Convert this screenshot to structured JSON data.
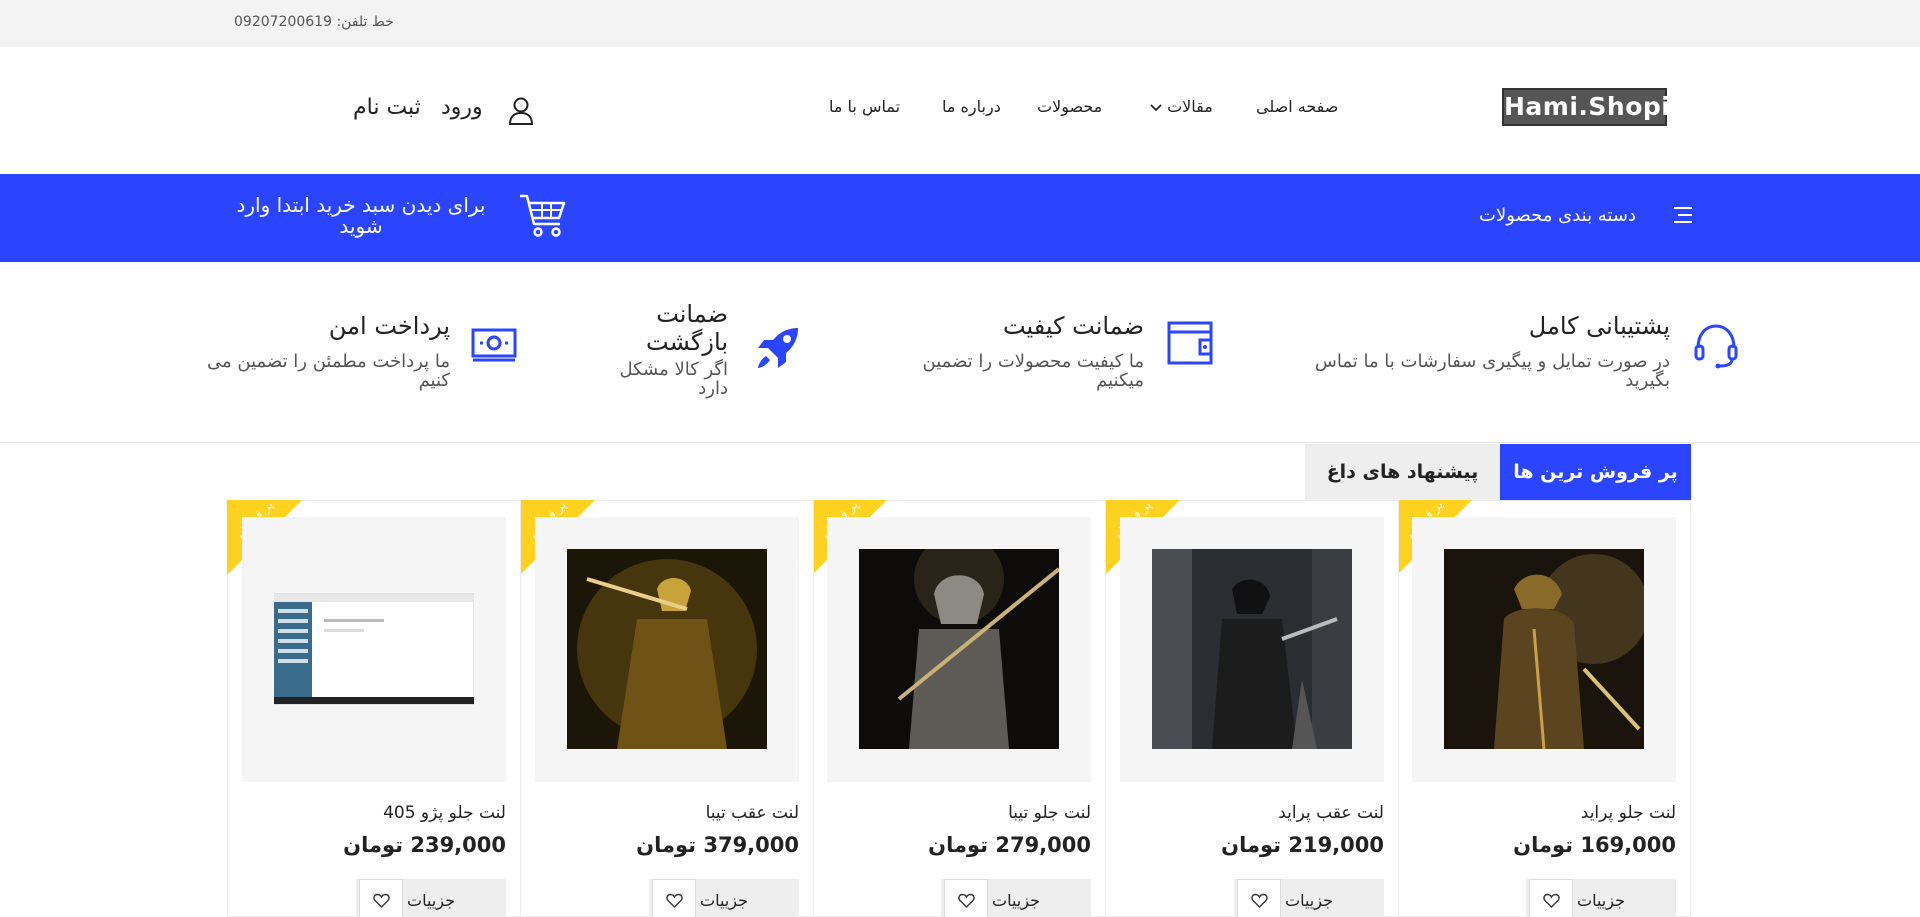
{
  "topbar": {
    "phone_label": "خط تلفن:",
    "phone_number": "09207200619"
  },
  "header": {
    "logo": "Hami.Shopi",
    "nav": {
      "home": "صفحه اصلی",
      "articles": "مقالات",
      "products": "محصولات",
      "about": "درباره ما",
      "contact": "تماس با ما"
    },
    "login": "ورود",
    "register": "ثبت نام"
  },
  "bluebar": {
    "categories": "دسته بندی محصولات",
    "cart_message": "برای دیدن سبد خرید ابتدا وارد شوید"
  },
  "features": [
    {
      "title": "پشتیبانی کامل",
      "desc": "در صورت تمایل و پیگیری سفارشات با ما تماس بگیرید",
      "icon": "headset-icon"
    },
    {
      "title": "ضمانت کیفیت",
      "desc": "ما کیفیت محصولات را تضمین میکنیم",
      "icon": "wallet-icon"
    },
    {
      "title": "ضمانت بازگشت",
      "desc": "اگر کالا مشکل دارد",
      "icon": "rocket-icon"
    },
    {
      "title": "پرداخت امن",
      "desc": "ما پرداخت مطمئن را تضمین می کنیم",
      "icon": "money-icon"
    }
  ],
  "tabs": {
    "bestsellers": "پر فروش ترین ها",
    "hot_offers": "پیشنهاد های داغ"
  },
  "products": [
    {
      "name": "لنت جلو پراید",
      "price": "169,000 تومان",
      "badge": "پر فروش",
      "details": "جزییات"
    },
    {
      "name": "لنت عقب پراید",
      "price": "219,000 تومان",
      "badge": "پر فروش",
      "details": "جزییات"
    },
    {
      "name": "لنت جلو تیبا",
      "price": "279,000 تومان",
      "badge": "پر فروش",
      "details": "جزییات"
    },
    {
      "name": "لنت عقب تیبا",
      "price": "379,000 تومان",
      "badge": "پر فروش",
      "details": "جزییات"
    },
    {
      "name": "لنت جلو پژو 405",
      "price": "239,000 تومان",
      "badge": "پر فروش",
      "details": "جزییات"
    }
  ],
  "colors": {
    "primary": "#2b45ff",
    "ribbon": "#ffd21f",
    "topbar": "#f3f3f3"
  }
}
